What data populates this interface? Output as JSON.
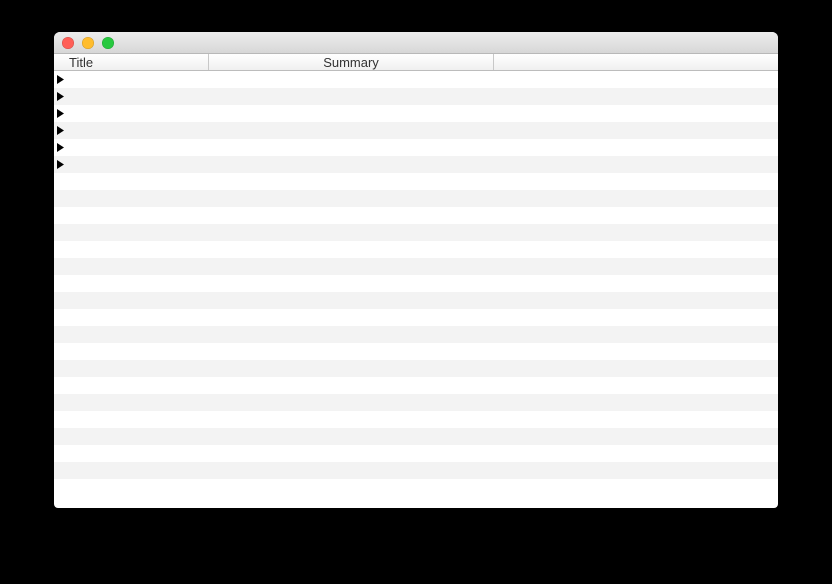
{
  "window": {
    "title": ""
  },
  "columns": {
    "title": "Title",
    "summary": "Summary"
  },
  "rows": [
    {
      "expandable": true,
      "title": "",
      "summary": ""
    },
    {
      "expandable": true,
      "title": "",
      "summary": ""
    },
    {
      "expandable": true,
      "title": "",
      "summary": ""
    },
    {
      "expandable": true,
      "title": "",
      "summary": ""
    },
    {
      "expandable": true,
      "title": "",
      "summary": ""
    },
    {
      "expandable": true,
      "title": "",
      "summary": ""
    }
  ],
  "total_visible_rows": 25
}
